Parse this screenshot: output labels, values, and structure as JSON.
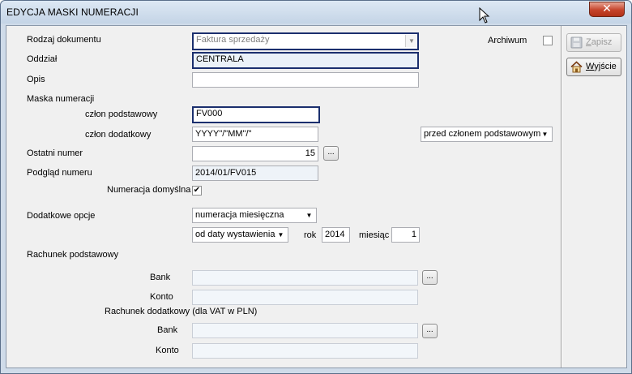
{
  "window": {
    "title": "EDYCJA MASKI NUMERACJI",
    "close_glyph": "✕"
  },
  "labels": {
    "rodzaj": "Rodzaj dokumentu",
    "oddzial": "Oddział",
    "opis": "Opis",
    "maska": "Maska numeracji",
    "czlon_podst": "człon podstawowy",
    "czlon_dod": "człon dodatkowy",
    "ostatni": "Ostatni numer",
    "podglad": "Podgląd numeru",
    "num_domyslna": "Numeracja domyślna",
    "dod_opcje": "Dodatkowe opcje",
    "rok": "rok",
    "miesiac": "miesiąc",
    "rach_podst": "Rachunek podstawowy",
    "bank1": "Bank",
    "konto1": "Konto",
    "rach_dod": "Rachunek dodatkowy (dla VAT w PLN)",
    "bank2": "Bank",
    "konto2": "Konto",
    "archiwum": "Archiwum"
  },
  "fields": {
    "rodzaj_value": "Faktura sprzedaży",
    "oddzial_value": "CENTRALA",
    "opis_value": "",
    "czlon_podst_value": "FV000",
    "czlon_dod_value": "YYYY\"/\"MM\"/\"",
    "pozycja_value": "przed członem podstawowym",
    "ostatni_value": "15",
    "podglad_value": "2014/01/FV015",
    "opcje_value": "numeracja miesięczna",
    "od_daty_value": "od daty wystawienia",
    "rok_value": "2014",
    "miesiac_value": "1",
    "bank1_value": "",
    "konto1_value": "",
    "bank2_value": "",
    "konto2_value": ""
  },
  "checkboxes": {
    "archiwum_checked": false,
    "num_domyslna_checked": true
  },
  "buttons": {
    "zapisz_prefix": "",
    "zapisz_hotkey": "Z",
    "zapisz_rest": "apisz",
    "wyjscie_prefix": "",
    "wyjscie_hotkey": "W",
    "wyjscie_rest": "yjście",
    "ellipsis": "..."
  },
  "icons": {
    "close": "close-icon",
    "save": "floppy-disk-icon",
    "exit": "home-icon",
    "dropdown": "chevron-down-icon",
    "cursor": "mouse-pointer-icon"
  },
  "colors": {
    "focus_border": "#1b2f6e",
    "titlebar": "#c4d4e6",
    "close_button": "#c5432a"
  }
}
